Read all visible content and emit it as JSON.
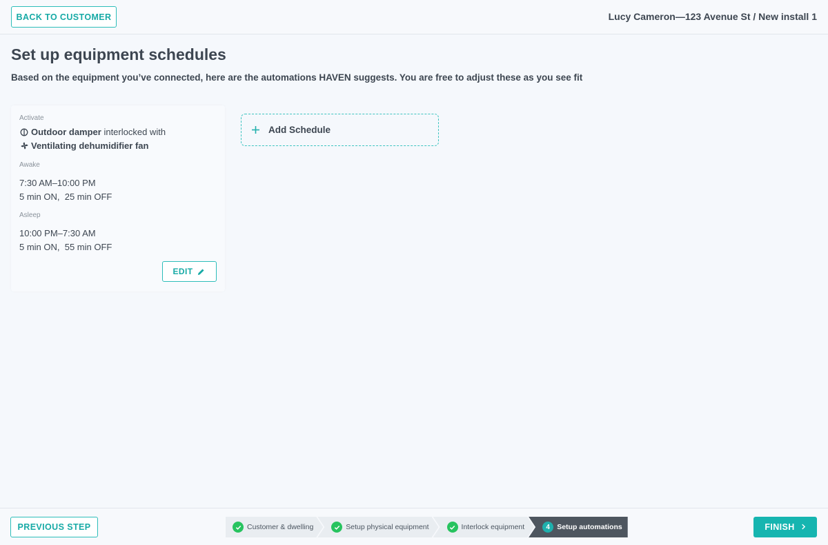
{
  "header": {
    "back_label": "BACK TO CUSTOMER",
    "customer_info": "Lucy Cameron—123 Avenue St / New install 1"
  },
  "page": {
    "title": "Set up equipment schedules",
    "subtitle": "Based on the equipment you’ve connected, here are the automations HAVEN suggests. You are free to adjust these as you see fit"
  },
  "schedule": {
    "activate_label": "Activate",
    "primary_icon": "damper-icon",
    "primary_device": "Outdoor damper",
    "interlock_text": " interlocked with",
    "secondary_icon": "fan-icon",
    "secondary_device": "Ventilating dehumidifier fan",
    "awake_label": "Awake",
    "awake_time": "7:30 AM–10:00 PM",
    "awake_cycle": "5 min ON,  25 min OFF",
    "asleep_label": "Asleep",
    "asleep_time": "10:00 PM–7:30 AM",
    "asleep_cycle": "5 min ON,  55 min OFF",
    "edit_label": "EDIT",
    "edit_icon": "pencil-icon"
  },
  "add_schedule": {
    "icon": "plus-icon",
    "label": "Add Schedule"
  },
  "footer": {
    "previous_label": "PREVIOUS STEP",
    "finish_label": "FINISH",
    "steps": [
      {
        "label": "Customer & dwelling",
        "status": "complete"
      },
      {
        "label": "Setup physical equipment",
        "status": "complete"
      },
      {
        "label": "Interlock equipment",
        "status": "complete"
      },
      {
        "number": "4",
        "label": "Setup automations",
        "status": "active"
      }
    ]
  },
  "colors": {
    "accent": "#16b5b0",
    "complete": "#27c35f",
    "active_step": "#4e565f",
    "text": "#3d4651"
  }
}
